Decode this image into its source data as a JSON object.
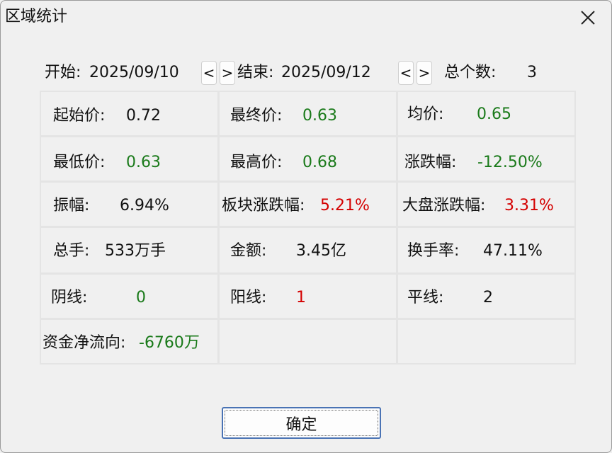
{
  "window": {
    "title": "区域统计"
  },
  "range": {
    "start_label": "开始:",
    "start_value": "2025/09/10",
    "end_label": "结束:",
    "end_value": "2025/09/12",
    "prev": "<",
    "next": ">",
    "count_label": "总个数:",
    "count_value": "3"
  },
  "stats": [
    {
      "label": "起始价:",
      "value": "0.72",
      "color": "black"
    },
    {
      "label": "最终价:",
      "value": "0.63",
      "color": "green"
    },
    {
      "label": "均价:",
      "value": "0.65",
      "color": "green"
    },
    {
      "label": "最低价:",
      "value": "0.63",
      "color": "green"
    },
    {
      "label": "最高价:",
      "value": "0.68",
      "color": "green"
    },
    {
      "label": "涨跌幅:",
      "value": "-12.50%",
      "color": "green"
    },
    {
      "label": "振幅:",
      "value": "6.94%",
      "color": "black"
    },
    {
      "label": "板块涨跌幅:",
      "value": "5.21%",
      "color": "red"
    },
    {
      "label": "大盘涨跌幅:",
      "value": "3.31%",
      "color": "red"
    },
    {
      "label": "总手:",
      "value": "533万手",
      "color": "black"
    },
    {
      "label": "金额:",
      "value": "3.45亿",
      "color": "black"
    },
    {
      "label": "换手率:",
      "value": "47.11%",
      "color": "black"
    },
    {
      "label": "阴线:",
      "value": "0",
      "color": "green"
    },
    {
      "label": "阳线:",
      "value": "1",
      "color": "red"
    },
    {
      "label": "平线:",
      "value": "2",
      "color": "black"
    },
    {
      "label": "资金净流向:",
      "value": "-6760万",
      "color": "green"
    }
  ],
  "colors": {
    "green": "#1a7a1a",
    "red": "#d40000",
    "focus_border": "#4a73b4"
  },
  "icons": {
    "close": "close-icon"
  },
  "buttons": {
    "ok": "确定"
  }
}
